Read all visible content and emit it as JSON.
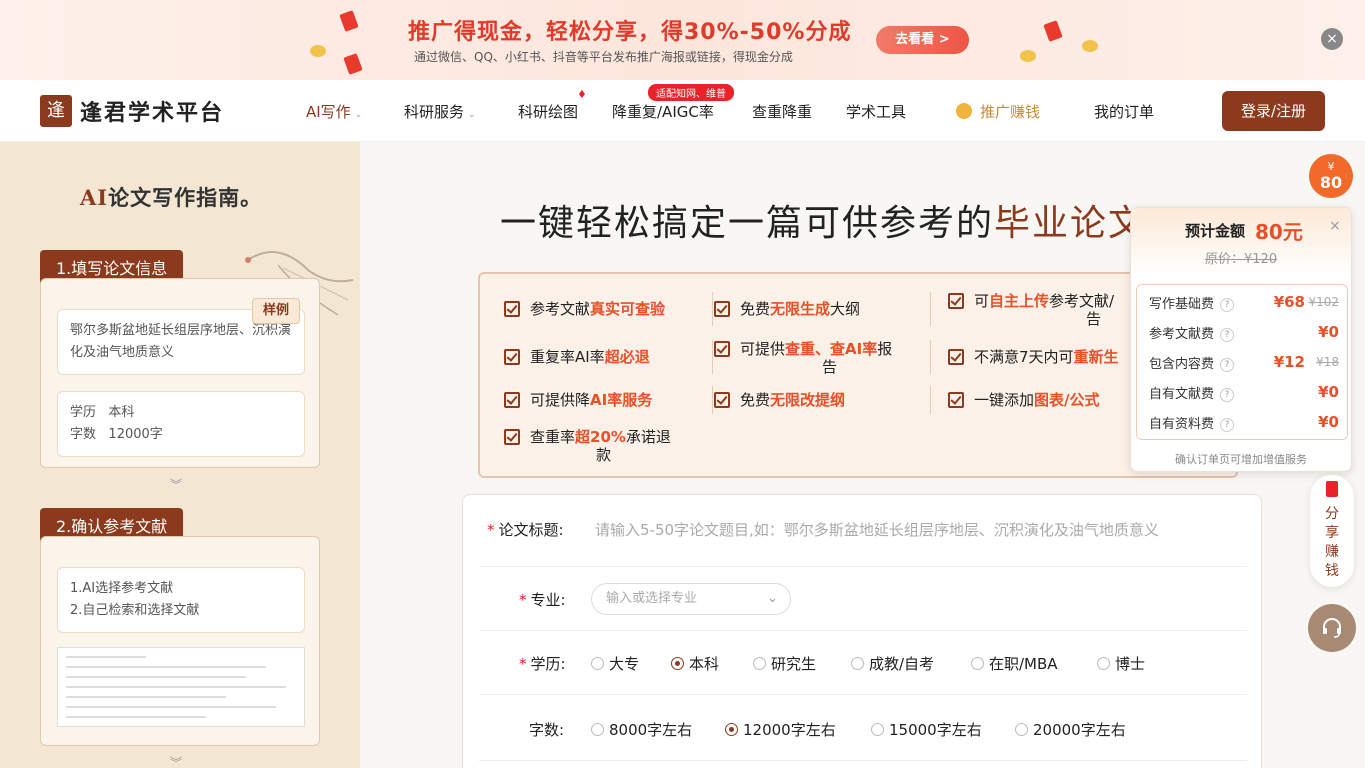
{
  "banner": {
    "title": "推广得现金，轻松分享，得30%-50%分成",
    "subtitle": "通过微信、QQ、小红书、抖音等平台发布推广海报或链接，得现金分成",
    "cta": "去看看 >",
    "close": "×"
  },
  "nav": {
    "logo_mark": "逢",
    "brand": "逢君学术平台",
    "items": [
      "AI写作",
      "科研服务",
      "科研绘图",
      "降重复/AIGC率",
      "查重降重",
      "学术工具",
      "推广赚钱",
      "我的订单"
    ],
    "tag": "适配知网、维普",
    "login": "登录/注册"
  },
  "guide": {
    "title_ai": "AI",
    "title_rest": "论文写作指南。",
    "step1": {
      "header": "1.填写论文信息",
      "sample": "样例",
      "example_title": "鄂尔多斯盆地延长组层序地层、沉积演化及油气地质意义",
      "degree_label": "学历",
      "degree_value": "本科",
      "words_label": "字数",
      "words_value": "12000字"
    },
    "step2": {
      "header": "2.确认参考文献",
      "line1": "1.AI选择参考文献",
      "line2": "2.自己检索和选择文献"
    }
  },
  "hero": {
    "text": "一键轻松搞定一篇可供参考的",
    "highlight": "毕业论文"
  },
  "features": [
    {
      "pre": "参考文献",
      "hl": "真实可查验",
      "post": ""
    },
    {
      "pre": "免费",
      "hl": "无限生成",
      "post": "大纲"
    },
    {
      "pre": "可",
      "hl": "自主上传",
      "post": "参考文献/"
    },
    {
      "pre": "重复率AI率",
      "hl": "超必退",
      "post": ""
    },
    {
      "pre": "可提供",
      "hl": "查重、查AI率",
      "post": "报"
    },
    {
      "pre": "不满意7天内可",
      "hl": "重新生",
      "post": ""
    },
    {
      "pre": "可提供降",
      "hl": "AI率服务",
      "post": ""
    },
    {
      "pre": "免费",
      "hl": "无限改提纲",
      "post": ""
    },
    {
      "pre": "一键添加",
      "hl": "图表/公式",
      "post": ""
    },
    {
      "pre": "查重率",
      "hl": "超20%",
      "post": "承诺退"
    }
  ],
  "feature_wraps": {
    "f3": "告",
    "f5": "告",
    "f10": "款"
  },
  "form": {
    "title_label": "论文标题:",
    "title_placeholder": "请输入5-50字论文题目,如：鄂尔多斯盆地延长组层序地层、沉积演化及油气地质意义",
    "major_label": "专业:",
    "major_placeholder": "输入或选择专业",
    "degree_label": "学历:",
    "degree_options": [
      "大专",
      "本科",
      "研究生",
      "成教/自考",
      "在职/MBA",
      "博士"
    ],
    "degree_selected": "本科",
    "words_label": "字数:",
    "words_options": [
      "8000字左右",
      "12000字左右",
      "15000字左右",
      "20000字左右"
    ],
    "words_selected": "12000字左右",
    "required_mark": "*"
  },
  "price": {
    "estimate_label": "预计金额",
    "amount": "80元",
    "original": "原价：¥120",
    "close": "×",
    "rows": [
      {
        "label": "写作基础费",
        "value": "¥68",
        "strike": "¥102"
      },
      {
        "label": "参考文献费",
        "value": "¥0",
        "strike": ""
      },
      {
        "label": "包含内容费",
        "value": "¥12",
        "strike": "¥18"
      },
      {
        "label": "自有文献费",
        "value": "¥0",
        "strike": ""
      },
      {
        "label": "自有资料费",
        "value": "¥0",
        "strike": ""
      }
    ],
    "help": "?",
    "footer": "确认订单页可增加增值服务"
  },
  "badge": {
    "symbol": "¥",
    "value": "80"
  },
  "share": {
    "chars": [
      "分",
      "享",
      "赚",
      "钱"
    ]
  },
  "colors": {
    "brand": "#8b3a1e",
    "accent": "#e8502a",
    "promo_red": "#e03a2a"
  }
}
